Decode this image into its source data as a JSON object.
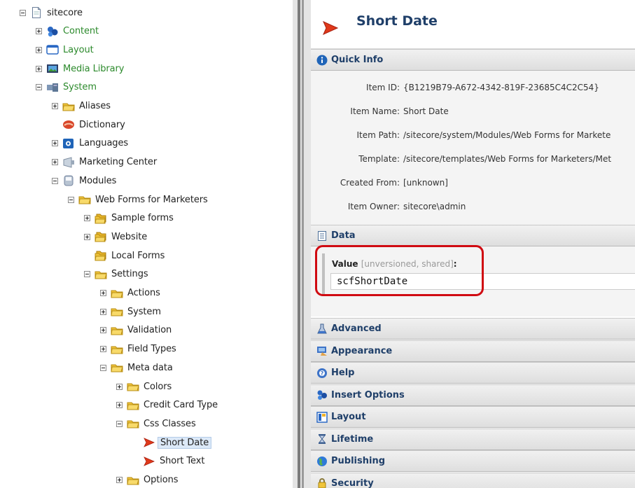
{
  "tree": {
    "root": {
      "label": "sitecore",
      "icon": "document-icon"
    },
    "items": [
      {
        "id": "content",
        "label": "Content",
        "icon": "content-icon",
        "expander": "plus",
        "green": true
      },
      {
        "id": "layout",
        "label": "Layout",
        "icon": "layout-window-icon",
        "expander": "plus",
        "green": true
      },
      {
        "id": "media-library",
        "label": "Media Library",
        "icon": "media-library-icon",
        "expander": "plus",
        "green": true
      },
      {
        "id": "system",
        "label": "System",
        "icon": "system-icon",
        "expander": "minus",
        "green": true
      },
      {
        "id": "aliases",
        "label": "Aliases",
        "icon": "folder-icon",
        "expander": "plus"
      },
      {
        "id": "dictionary",
        "label": "Dictionary",
        "icon": "dictionary-book-icon",
        "expander": "none"
      },
      {
        "id": "languages",
        "label": "Languages",
        "icon": "languages-icon",
        "expander": "plus"
      },
      {
        "id": "marketing-center",
        "label": "Marketing Center",
        "icon": "marketing-center-icon",
        "expander": "plus"
      },
      {
        "id": "modules",
        "label": "Modules",
        "icon": "modules-icon",
        "expander": "minus"
      },
      {
        "id": "web-forms",
        "label": "Web Forms for Marketers",
        "icon": "folder-icon",
        "expander": "minus"
      },
      {
        "id": "sample-forms",
        "label": "Sample forms",
        "icon": "folder-stack-icon",
        "expander": "plus"
      },
      {
        "id": "website",
        "label": "Website",
        "icon": "folder-stack-icon",
        "expander": "plus"
      },
      {
        "id": "local-forms",
        "label": "Local Forms",
        "icon": "folder-stack-icon",
        "expander": "none"
      },
      {
        "id": "settings",
        "label": "Settings",
        "icon": "folder-icon",
        "expander": "minus"
      },
      {
        "id": "actions",
        "label": "Actions",
        "icon": "folder-icon",
        "expander": "plus"
      },
      {
        "id": "system-2",
        "label": "System",
        "icon": "folder-icon",
        "expander": "plus"
      },
      {
        "id": "validation",
        "label": "Validation",
        "icon": "folder-icon",
        "expander": "plus"
      },
      {
        "id": "field-types",
        "label": "Field Types",
        "icon": "folder-icon",
        "expander": "plus"
      },
      {
        "id": "meta-data",
        "label": "Meta data",
        "icon": "folder-icon",
        "expander": "minus"
      },
      {
        "id": "colors",
        "label": "Colors",
        "icon": "folder-icon",
        "expander": "plus"
      },
      {
        "id": "credit-card-type",
        "label": "Credit Card Type",
        "icon": "folder-icon",
        "expander": "plus"
      },
      {
        "id": "css-classes",
        "label": "Css Classes",
        "icon": "folder-icon",
        "expander": "minus"
      },
      {
        "id": "short-date",
        "label": "Short Date",
        "icon": "red-arrow-icon",
        "expander": "none",
        "selected": true
      },
      {
        "id": "short-text",
        "label": "Short Text",
        "icon": "red-arrow-icon",
        "expander": "none"
      },
      {
        "id": "options",
        "label": "Options",
        "icon": "folder-icon",
        "expander": "plus"
      }
    ]
  },
  "header": {
    "title": "Short Date",
    "icon": "red-arrow-icon"
  },
  "quick_info": {
    "title": "Quick Info",
    "icon": "info-icon",
    "fields": [
      {
        "key": "Item ID:",
        "value": "{B1219B79-A672-4342-819F-23685C4C2C54}"
      },
      {
        "key": "Item Name:",
        "value": "Short Date"
      },
      {
        "key": "Item Path:",
        "value": "/sitecore/system/Modules/Web Forms for Markete"
      },
      {
        "key": "Template:",
        "value": "/sitecore/templates/Web Forms for Marketers/Met"
      },
      {
        "key": "Created From:",
        "value": "[unknown]"
      },
      {
        "key": "Item Owner:",
        "value": "sitecore\\admin"
      }
    ]
  },
  "data_section": {
    "title": "Data",
    "icon": "data-icon",
    "field_label": "Value",
    "field_meta": "[unversioned, shared]",
    "field_colon": ":",
    "field_value": "scfShortDate"
  },
  "sections": [
    {
      "id": "advanced",
      "title": "Advanced",
      "icon": "flask-icon"
    },
    {
      "id": "appearance",
      "title": "Appearance",
      "icon": "appearance-icon"
    },
    {
      "id": "help",
      "title": "Help",
      "icon": "help-icon"
    },
    {
      "id": "insert-options",
      "title": "Insert Options",
      "icon": "insert-options-icon"
    },
    {
      "id": "layout",
      "title": "Layout",
      "icon": "layout-icon"
    },
    {
      "id": "lifetime",
      "title": "Lifetime",
      "icon": "hourglass-icon"
    },
    {
      "id": "publishing",
      "title": "Publishing",
      "icon": "globe-icon"
    },
    {
      "id": "security",
      "title": "Security",
      "icon": "lock-icon"
    }
  ],
  "colors": {
    "accent": "#1f3f69",
    "highlight": "#d00b12",
    "green_label": "#2c8a2c"
  }
}
